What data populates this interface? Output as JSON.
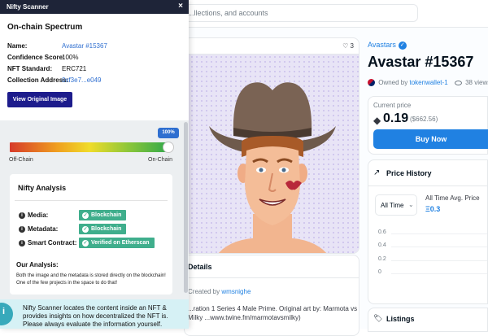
{
  "marketplace": {
    "search_placeholder": "...llections, and accounts",
    "favorites_count": "3",
    "collection_name": "Avastars",
    "item_title": "Avastar #15367",
    "owned_prefix": "Owned by",
    "owner": "tokenwallet-1",
    "views": "38 views",
    "current_price_label": "Current price",
    "price": "0.19",
    "price_usd": "($662.56)",
    "buy_label": "Buy Now",
    "price_history_title": "Price History",
    "time_range": "All Time",
    "avg_price_label": "All Time Avg. Price",
    "avg_price_value": "Ξ0.3",
    "axis_ticks": [
      "0.6",
      "0.4",
      "0.2",
      "0"
    ],
    "details_title": "Details",
    "created_by_prefix": "Created by",
    "creator": "wmsnighe",
    "description": "...ration 1 Series 4 Male Prime. Original art by: Marmota vs Milky ...www.twine.fm/marmotavsmilky)",
    "listings_title": "Listings"
  },
  "scanner": {
    "header_title": "Nifty Scanner",
    "close_symbol": "×",
    "section_title": "On-chain Spectrum",
    "rows": [
      {
        "label": "Name:",
        "value": "Avastar #15367"
      },
      {
        "label": "Confidence Score:",
        "value": "100%"
      },
      {
        "label": "NFT Standard:",
        "value": "ERC721"
      },
      {
        "label": "Collection Address:",
        "value": "0xf3e7...e049"
      }
    ],
    "view_button": "View Original Image",
    "spectrum_percent": "100%",
    "spectrum_fraction": 1.0,
    "off_chain_label": "Off-Chain",
    "on_chain_label": "On-Chain",
    "analysis_title": "Nifty Analysis",
    "analysis_rows": [
      {
        "label": "Media:",
        "badge": "Blockchain"
      },
      {
        "label": "Metadata:",
        "badge": "Blockchain"
      },
      {
        "label": "Smart Contract:",
        "badge": "Verified on Etherscan"
      }
    ],
    "our_analysis_title": "Our Analysis:",
    "our_analysis_text": "Both the image and the metadata is stored directly on the blockchain! One of the few projects in the space to do that!",
    "footer_text": "Nifty Scanner locates the content inside an NFT & provides insights on how decentralized the NFT is. Please always evaluate the information yourself.",
    "colors": {
      "header": "#1e2438",
      "button": "#1d1c8c",
      "badge": "#3fae8c",
      "accent": "#2f6fd0"
    }
  }
}
